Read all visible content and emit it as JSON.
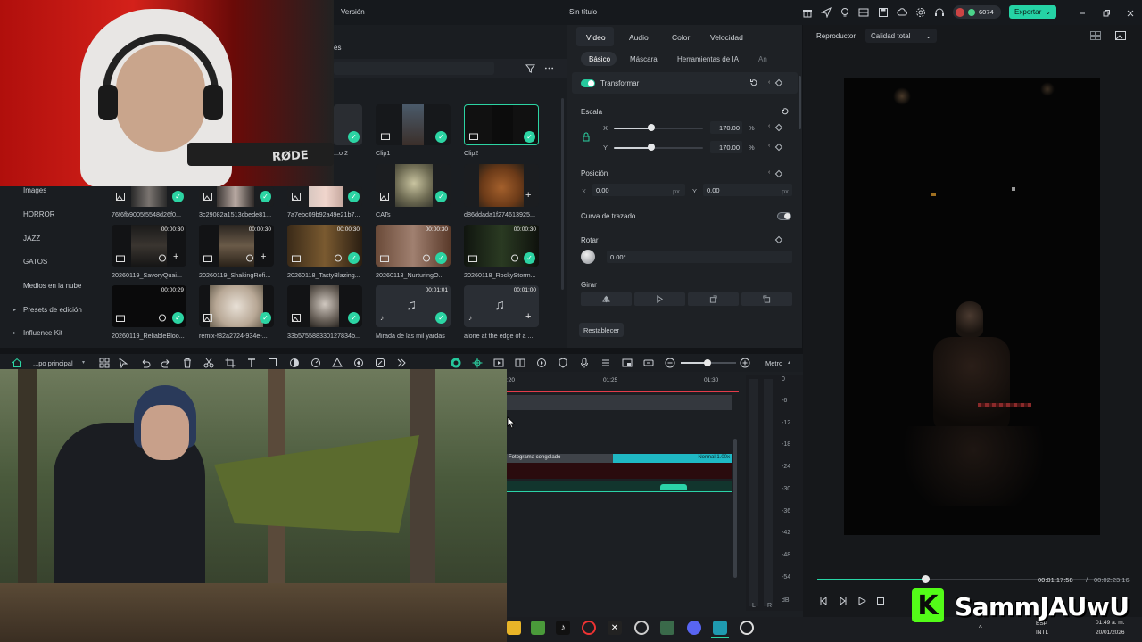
{
  "titlebar": {
    "menu_version": "Versión",
    "project_title": "Sin título",
    "credits": "6074",
    "export_label": "Exportar"
  },
  "media": {
    "partial_tab": "es",
    "sidebar": [
      "Images",
      "HORROR",
      "JAZZ",
      "GATOS",
      "Medios en la nube",
      "Presets de edición",
      "Influence Kit"
    ],
    "rows": [
      [
        {
          "label": "...o 2",
          "duration": "",
          "status": "check"
        },
        {
          "label": "Clip1",
          "duration": "",
          "status": "check"
        },
        {
          "label": "Clip2",
          "duration": "",
          "status": "check"
        }
      ],
      [
        {
          "label": "76f6fb9005f5548d26f0...",
          "duration": "",
          "status": "check"
        },
        {
          "label": "3c29082a1513cbede81...",
          "duration": "",
          "status": "check"
        },
        {
          "label": "7a7ebc09b92a49e21b7...",
          "duration": "",
          "status": "check"
        },
        {
          "label": "CATs",
          "duration": "",
          "status": "check"
        },
        {
          "label": "d86ddada1f274613925...",
          "duration": "",
          "status": "plus"
        }
      ],
      [
        {
          "label": "20260119_SavoryQuai...",
          "duration": "00:00:30",
          "status": "plus"
        },
        {
          "label": "20260119_ShakingRefi...",
          "duration": "00:00:30",
          "status": "plus"
        },
        {
          "label": "20260118_TastyBlazing...",
          "duration": "00:00:30",
          "status": "check"
        },
        {
          "label": "20260118_NurturingO...",
          "duration": "00:00:30",
          "status": "check"
        },
        {
          "label": "20260118_RockyStorm...",
          "duration": "00:00:30",
          "status": "check"
        }
      ],
      [
        {
          "label": "20260119_ReliableBloo...",
          "duration": "00:00:29",
          "status": "check"
        },
        {
          "label": "remix-f82a2724-934e-...",
          "duration": "",
          "status": "check"
        },
        {
          "label": "33b575588330127834b...",
          "duration": "",
          "status": "check"
        },
        {
          "label": "Mirada de las mil yardas",
          "duration": "00:01:01",
          "status": "check"
        },
        {
          "label": "alone at the edge of a ...",
          "duration": "00:01:00",
          "status": "plus"
        }
      ]
    ]
  },
  "inspector": {
    "tabs": [
      "Video",
      "Audio",
      "Color",
      "Velocidad"
    ],
    "subtabs": [
      "Básico",
      "Máscara",
      "Herramientas de IA",
      "An"
    ],
    "transform_label": "Transformar",
    "scale_label": "Escala",
    "scale_x": "170.00",
    "scale_y": "170.00",
    "scale_unit": "%",
    "scale_fraction": 0.42,
    "axis_x": "X",
    "axis_y": "Y",
    "position_label": "Posición",
    "pos_x": "0.00",
    "pos_y": "0.00",
    "pos_unit": "px",
    "path_curve_label": "Curva de trazado",
    "rotate_label": "Rotar",
    "rotate_value": "0.00°",
    "flip_label": "Girar",
    "reset_label": "Restablecer"
  },
  "player": {
    "label": "Reproductor",
    "quality": "Calidad total",
    "current_time": "00:01:17:58",
    "separator": "/",
    "total_time": "00:02:23:16",
    "progress": 0.35
  },
  "timeline": {
    "track_name": "...po principal",
    "zoom_label": "Metro",
    "ruler": [
      ":20",
      "01:25",
      "01:30"
    ],
    "clip_freeze": "Fotograma congelado",
    "clip_speed": "Normal 1.00x",
    "db_scale": [
      "0",
      "-6",
      "-12",
      "-18",
      "-24",
      "-30",
      "-36",
      "-42",
      "-48",
      "-54",
      "dB"
    ],
    "meter_lr": [
      "L",
      "R"
    ]
  },
  "taskbar": {
    "lang": "ESP",
    "lang_sub": "INTL",
    "time": "01:49 a. m.",
    "date": "20/01/2026"
  },
  "watermark": {
    "logo_letter": "K",
    "name": "SammJAUwU"
  },
  "colors": {
    "accent": "#25d3a5",
    "playhead": "#e33c4a",
    "background": "#1a1d21"
  }
}
